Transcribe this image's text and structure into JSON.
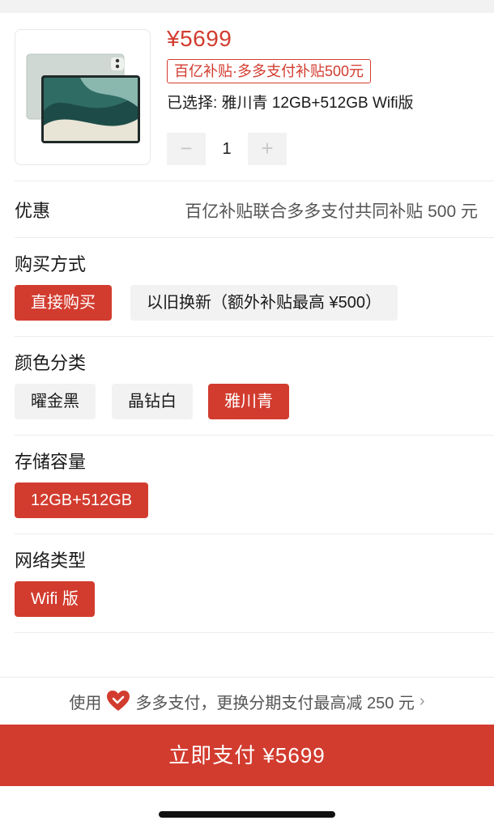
{
  "product": {
    "price": "¥5699",
    "subsidy_tag": "百亿补贴·多多支付补贴500元",
    "selected_spec": "已选择: 雅川青 12GB+512GB Wifi版",
    "quantity": "1",
    "minus_label": "−",
    "plus_label": "+"
  },
  "promo": {
    "label": "优惠",
    "value": "百亿补贴联合多多支付共同补贴 500 元"
  },
  "purchase_method": {
    "title": "购买方式",
    "options": [
      {
        "label": "直接购买",
        "selected": true
      },
      {
        "label": "以旧换新（额外补贴最高 ¥500）",
        "selected": false
      }
    ]
  },
  "color": {
    "title": "颜色分类",
    "options": [
      {
        "label": "曜金黑",
        "selected": false
      },
      {
        "label": "晶钻白",
        "selected": false
      },
      {
        "label": "雅川青",
        "selected": true
      }
    ]
  },
  "storage": {
    "title": "存储容量",
    "options": [
      {
        "label": "12GB+512GB",
        "selected": true
      }
    ]
  },
  "network": {
    "title": "网络类型",
    "options": [
      {
        "label": "Wifi 版",
        "selected": true
      }
    ]
  },
  "pay_hint": {
    "prefix": "使用",
    "text": "多多支付，更换分期支付最高减 250 元",
    "chevron": "›"
  },
  "pay_button": {
    "label": "立即支付 ¥5699"
  },
  "colors": {
    "accent": "#d23c2f",
    "chip_bg": "#f2f2f2"
  },
  "icons": {
    "heart": "duoduo-pay-heart-icon",
    "chevron": "chevron-right-icon"
  }
}
